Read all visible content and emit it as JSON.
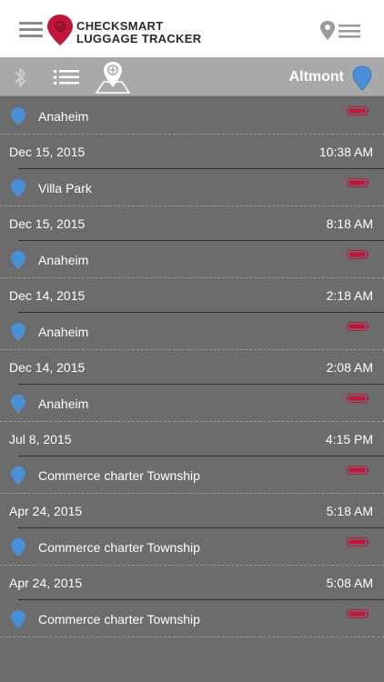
{
  "header": {
    "logo_line1": "CHECKSMART",
    "logo_line2": "LUGGAGE TRACKER",
    "logo_color": "#c0163c"
  },
  "toolbar": {
    "location": "Altmont",
    "pin_color": "#4a90d9"
  },
  "entries": [
    {
      "location": "Anaheim",
      "date": "Dec 15, 2015",
      "time": "10:38 AM"
    },
    {
      "location": "Villa Park",
      "date": "Dec 15, 2015",
      "time": "8:18 AM"
    },
    {
      "location": "Anaheim",
      "date": "Dec 14, 2015",
      "time": "2:18 AM"
    },
    {
      "location": "Anaheim",
      "date": "Dec 14, 2015",
      "time": "2:08 AM"
    },
    {
      "location": "Anaheim",
      "date": "Jul 8, 2015",
      "time": "4:15 PM"
    },
    {
      "location": "Commerce charter Township",
      "date": "Apr 24, 2015",
      "time": "5:18 AM"
    },
    {
      "location": "Commerce charter Township",
      "date": "Apr 24, 2015",
      "time": "5:08 AM"
    },
    {
      "location": "Commerce charter Township",
      "date": "",
      "time": ""
    }
  ],
  "battery_color": "#c0163c"
}
